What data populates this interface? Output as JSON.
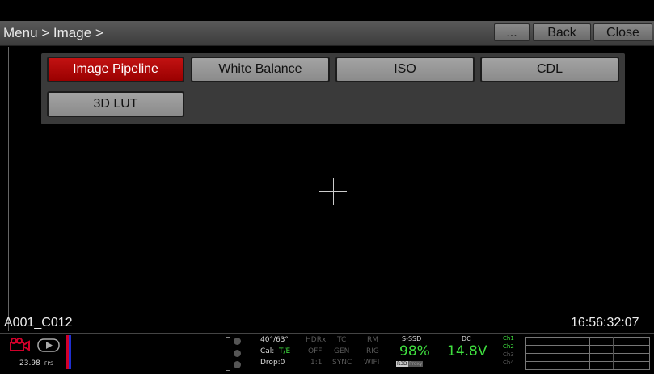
{
  "topbar": {
    "breadcrumb": "Menu > Image >",
    "more_label": "...",
    "back_label": "Back",
    "close_label": "Close"
  },
  "menu": {
    "items": [
      {
        "label": "Image Pipeline",
        "active": true
      },
      {
        "label": "White Balance",
        "active": false
      },
      {
        "label": "ISO",
        "active": false
      },
      {
        "label": "CDL",
        "active": false
      },
      {
        "label": "3D LUT",
        "active": false
      }
    ]
  },
  "overlay": {
    "clip_name": "A001_C012",
    "timecode": "16:56:32:07"
  },
  "status": {
    "fps": "23.98",
    "fps_unit": "FPS",
    "temp": "40°/63°",
    "cal_label": "Cal:",
    "cal_value": "T/E",
    "drop": "Drop:0",
    "col1": [
      "HDRx",
      "OFF",
      "1:1"
    ],
    "col2": [
      "TC",
      "GEN",
      "SYNC"
    ],
    "col3": [
      "RM",
      "RIG",
      "WIFI"
    ],
    "media_label": "S-SSD",
    "media_percent": "98%",
    "media_tags": [
      "R3D",
      "Proxy"
    ],
    "power_label": "DC",
    "power_value": "14.8V",
    "channels": [
      "Ch1",
      "Ch2",
      "Ch3",
      "Ch4"
    ]
  },
  "colors": {
    "accent_red": "#b00000",
    "status_green": "#3fe03f"
  }
}
